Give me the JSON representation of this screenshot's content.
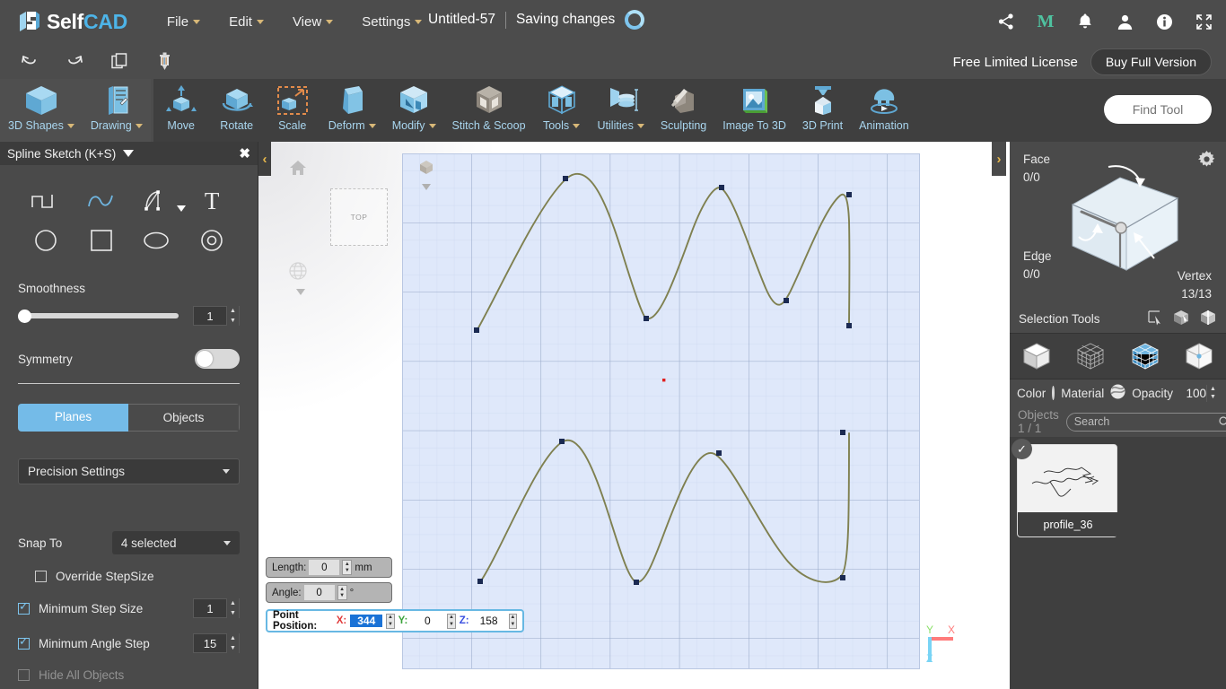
{
  "app": {
    "brand_self": "Self",
    "brand_cad": "CAD",
    "doc_title": "Untitled-57",
    "saving_status": "Saving changes"
  },
  "menu": [
    {
      "label": "File",
      "caret": true
    },
    {
      "label": "Edit",
      "caret": true
    },
    {
      "label": "View",
      "caret": true
    },
    {
      "label": "Settings",
      "caret": true
    }
  ],
  "top_icons": [
    {
      "name": "share-icon"
    },
    {
      "name": "mentor-m-icon",
      "label": "M"
    },
    {
      "name": "bell-icon"
    },
    {
      "name": "user-icon"
    },
    {
      "name": "info-icon"
    },
    {
      "name": "fullscreen-icon"
    }
  ],
  "license": {
    "label": "Free Limited License",
    "buy_label": "Buy Full Version"
  },
  "quickbar": [
    {
      "name": "undo-icon"
    },
    {
      "name": "redo-icon"
    },
    {
      "name": "copy-icon"
    },
    {
      "name": "delete-icon"
    }
  ],
  "ribbon": {
    "items": [
      {
        "label": "3D Shapes",
        "caret": true,
        "selected": false
      },
      {
        "label": "Drawing",
        "caret": true,
        "selected": true
      },
      {
        "label": "Move",
        "caret": false,
        "selected": false
      },
      {
        "label": "Rotate",
        "caret": false,
        "selected": false
      },
      {
        "label": "Scale",
        "caret": false,
        "selected": false
      },
      {
        "label": "Deform",
        "caret": true,
        "selected": false
      },
      {
        "label": "Modify",
        "caret": true,
        "selected": false
      },
      {
        "label": "Stitch & Scoop",
        "caret": false,
        "selected": false
      },
      {
        "label": "Tools",
        "caret": true,
        "selected": false
      },
      {
        "label": "Utilities",
        "caret": true,
        "selected": false
      },
      {
        "label": "Sculpting",
        "caret": false,
        "selected": false
      },
      {
        "label": "Image To 3D",
        "caret": false,
        "selected": false
      },
      {
        "label": "3D Print",
        "caret": false,
        "selected": false
      },
      {
        "label": "Animation",
        "caret": false,
        "selected": false
      }
    ],
    "find_tool_placeholder": "Find Tool"
  },
  "left_panel": {
    "title": "Spline Sketch (K+S)",
    "tools": [
      {
        "name": "polyline-icon"
      },
      {
        "name": "spline-curve-icon"
      },
      {
        "name": "freehand-pen-icon"
      },
      {
        "name": "text-icon"
      },
      {
        "name": "circle-icon"
      },
      {
        "name": "square-icon"
      },
      {
        "name": "ellipse-icon"
      },
      {
        "name": "concentric-circle-icon"
      }
    ],
    "smoothness_label": "Smoothness",
    "smoothness_value": "1",
    "symmetry_label": "Symmetry",
    "symmetry_on": false,
    "seg_planes": "Planes",
    "seg_objects": "Objects",
    "precision_settings": "Precision Settings",
    "snap_to_label": "Snap To",
    "snap_to_value": "4 selected",
    "override_stepsize_label": "Override StepSize",
    "override_stepsize_checked": false,
    "min_step_size_label": "Minimum Step Size",
    "min_step_size_value": "1",
    "min_step_size_checked": true,
    "min_angle_step_label": "Minimum Angle Step",
    "min_angle_step_value": "15",
    "min_angle_step_checked": true,
    "hide_all_objects_label": "Hide All Objects",
    "hide_all_objects_checked": false
  },
  "viewport": {
    "view_cube_label": "TOP",
    "axis": {
      "x": "X",
      "y": "Y",
      "z": "Z"
    },
    "length": {
      "label": "Length:",
      "value": "0",
      "unit": "mm"
    },
    "angle": {
      "label": "Angle:",
      "value": "0",
      "unit": "°"
    },
    "point_position": {
      "label": "Point Position:",
      "x_axis": "X:",
      "x_value": "344",
      "y_axis": "Y:",
      "y_value": "0",
      "z_axis": "Z:",
      "z_value": "158"
    }
  },
  "right_panel": {
    "face_label": "Face",
    "face_value": "0/0",
    "edge_label": "Edge",
    "edge_value": "0/0",
    "vertex_label": "Vertex",
    "vertex_value": "13/13",
    "selection_tools_label": "Selection Tools",
    "selection_tool_icons": [
      {
        "name": "rect-select-icon"
      },
      {
        "name": "box-select-icon"
      },
      {
        "name": "loop-select-icon"
      }
    ],
    "mode_icons": [
      {
        "name": "object-mode-icon"
      },
      {
        "name": "wireframe-mode-icon"
      },
      {
        "name": "face-mode-icon"
      },
      {
        "name": "vertex-mode-icon"
      }
    ],
    "color_label": "Color",
    "material_label": "Material",
    "opacity_label": "Opacity",
    "opacity_value": "100",
    "objects_count_label": "Objects 1 / 1",
    "search_placeholder": "Search",
    "objects": [
      {
        "name": "profile_36",
        "selected": true
      }
    ]
  },
  "colors": {
    "accent_blue": "#74bbe8",
    "brand_cyan": "#4db4e8",
    "panel_bg": "#4a4a4a",
    "ribbon_bg": "#3f3f3f",
    "topbar_bg": "#4c4c4c",
    "sketch_plane": "#dfe8fa",
    "spline_stroke": "#7f8050",
    "gold_caret": "#d8b878",
    "axis_x": "#ff7b7b",
    "axis_y": "#8ce06a",
    "axis_z": "#79d4f5"
  },
  "chart_data": {
    "type": "line",
    "title": "",
    "series": [
      {
        "name": "spline-top",
        "points": [
          [
            531,
            369
          ],
          [
            630,
            200
          ],
          [
            720,
            355
          ],
          [
            804,
            210
          ],
          [
            876,
            336
          ],
          [
            946,
            218
          ],
          [
            946,
            363
          ]
        ]
      },
      {
        "name": "spline-bottom",
        "points": [
          [
            535,
            653
          ],
          [
            626,
            494
          ],
          [
            719,
            653
          ],
          [
            801,
            510
          ],
          [
            941,
            648
          ],
          [
            941,
            487
          ]
        ]
      }
    ],
    "grid": true,
    "axis_labels": [
      "X",
      "Y",
      "Z"
    ]
  }
}
